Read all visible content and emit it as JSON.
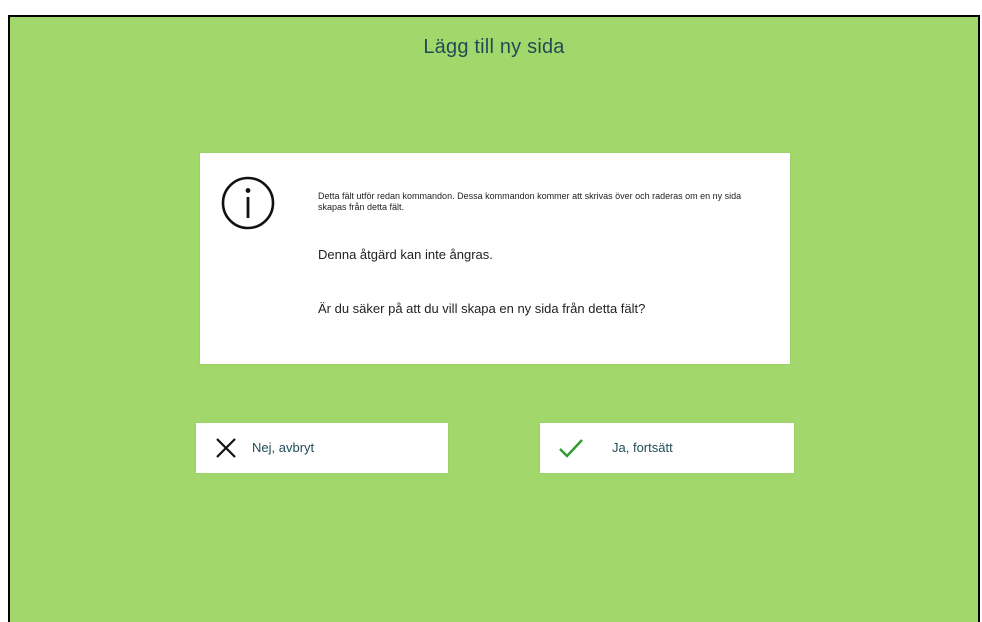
{
  "dialog": {
    "title": "Lägg till ny sida",
    "info_icon": "info-circle-icon",
    "warning_text": "Detta fält utför redan kommandon. Dessa kommandon kommer att skrivas över och raderas om en ny sida skapas från detta fält.",
    "undo_notice": "Denna åtgärd kan inte ångras.",
    "confirm_question": "Är du säker på att du vill skapa en ny sida från detta fält?"
  },
  "buttons": {
    "cancel_label": "Nej, avbryt",
    "cancel_icon": "close-icon",
    "confirm_label": "Ja, fortsätt",
    "confirm_icon": "checkmark-icon"
  },
  "colors": {
    "background": "#a2d76b",
    "title_text": "#1f4d57",
    "confirm_check": "#2e9a2e"
  }
}
